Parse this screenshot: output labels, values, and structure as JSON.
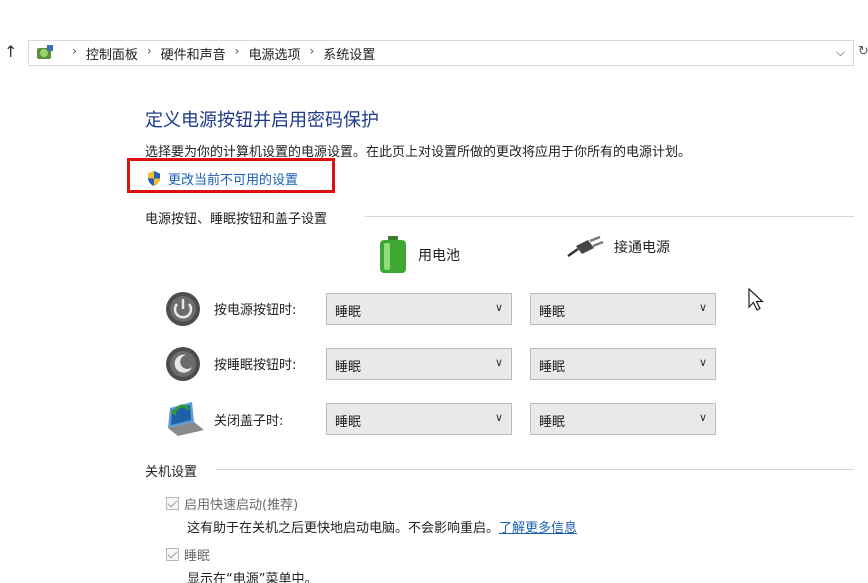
{
  "breadcrumb": {
    "items": [
      "控制面板",
      "硬件和声音",
      "电源选项",
      "系统设置"
    ],
    "separator": "›"
  },
  "page": {
    "title": "定义电源按钮并启用密码保护",
    "description": "选择要为你的计算机设置的电源设置。在此页上对设置所做的更改将应用于你所有的电源计划。",
    "unlock_link": "更改当前不可用的设置",
    "highlight_color": "#e01010"
  },
  "buttons_section": {
    "heading": "电源按钮、睡眠按钮和盖子设置",
    "col_battery": "用电池",
    "col_plugged": "接通电源",
    "rows": [
      {
        "label": "按电源按钮时:",
        "battery": "睡眠",
        "plugged": "睡眠",
        "icon": "power-button-icon"
      },
      {
        "label": "按睡眠按钮时:",
        "battery": "睡眠",
        "plugged": "睡眠",
        "icon": "sleep-button-icon"
      },
      {
        "label": "关闭盖子时:",
        "battery": "睡眠",
        "plugged": "睡眠",
        "icon": "laptop-lid-icon"
      }
    ]
  },
  "shutdown_section": {
    "heading": "关机设置",
    "fast_startup_label": "启用快速启动(推荐)",
    "fast_startup_desc": "这有助于在关机之后更快地启动电脑。不会影响重启。",
    "learn_more": "了解更多信息",
    "sleep_label": "睡眠",
    "sleep_desc": "显示在“电源”菜单中。"
  }
}
